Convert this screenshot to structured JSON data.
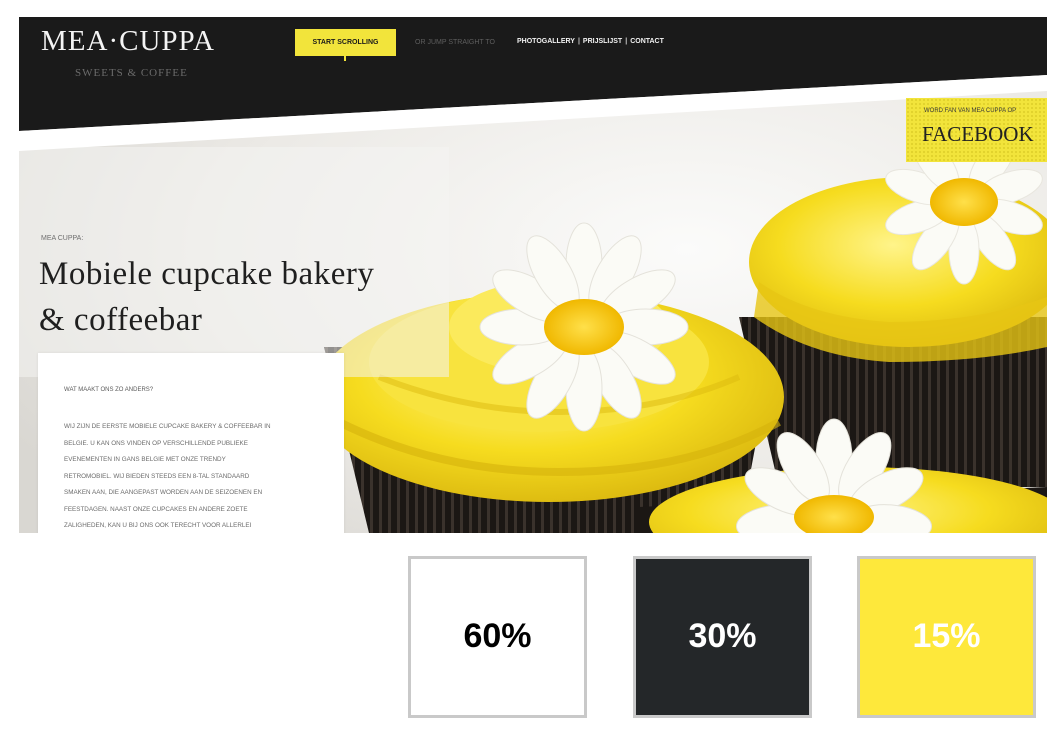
{
  "colors": {
    "brand_dark": "#1a1a1a",
    "brand_yellow": "#f2e43b",
    "frosting": "#f6dc1f",
    "wrapper": "#1b1714"
  },
  "site": {
    "logo": {
      "title": "MEA·CUPPA",
      "subtitle": "SWEETS & COFFEE"
    },
    "nav": {
      "start_label": "START SCROLLING",
      "jump_label": "OR JUMP STRAIGHT TO",
      "links": [
        "PHOTOGALLERY",
        "PRIJSLIJST",
        "CONTACT"
      ],
      "separator": "|"
    },
    "facebook": {
      "small": "WORD FAN VAN MEA CUPPA OP",
      "big": "FACEBOOK"
    },
    "hero": {
      "kicker": "MEA CUPPA:",
      "headline_lines": [
        "Mobiele cupcake bakery",
        "& coffeebar"
      ]
    },
    "textbox": {
      "title": "WAT MAAKT ONS ZO ANDERS?",
      "lines": [
        "WIJ ZIJN DE EERSTE MOBIELE CUPCAKE BAKERY & COFFEEBAR IN",
        "BELGIE. U KAN ONS VINDEN OP VERSCHILLENDE PUBLIEKE",
        "EVENEMENTEN IN GANS BELGIE MET ONZE TRENDY",
        "RETROMOBIEL. WIJ BIEDEN STEEDS EEN 8-TAL STANDAARD",
        "SMAKEN AAN, DIE AANGEPAST WORDEN AAN DE SEIZOENEN EN",
        "FEESTDAGEN. NAAST ONZE CUPCAKES EN ANDERE ZOETE",
        "ZALIGHEDEN, KAN U BIJ ONS OOK TERECHT VOOR ALLERLEI"
      ]
    }
  },
  "palette": [
    {
      "label": "60%",
      "value": 60,
      "color": "#ffffff"
    },
    {
      "label": "30%",
      "value": 30,
      "color": "#242729"
    },
    {
      "label": "15%",
      "value": 15,
      "color": "#fee83b"
    }
  ]
}
